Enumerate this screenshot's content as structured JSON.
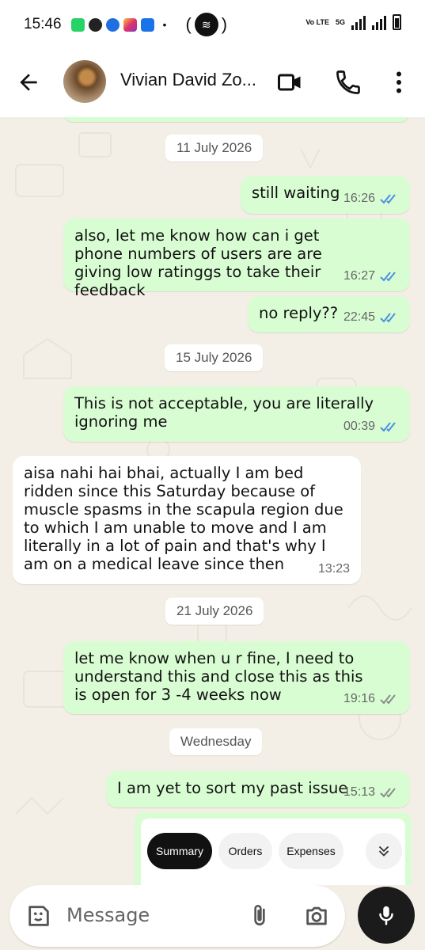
{
  "status_bar": {
    "time": "15:46",
    "network_top": "Vo LTE",
    "network_label": "5G"
  },
  "header": {
    "contact_name": "Vivian David Zo..."
  },
  "messages": [
    {
      "type": "date",
      "text": "11 July 2026"
    },
    {
      "type": "out",
      "text": "still waiting",
      "time": "16:26",
      "status": "read"
    },
    {
      "type": "out",
      "text": "also, let me know how can i get phone numbers of users are are giving low ratinggs to take their feedback",
      "time": "16:27",
      "status": "read"
    },
    {
      "type": "out",
      "text": "no reply??",
      "time": "22:45",
      "status": "read"
    },
    {
      "type": "date",
      "text": "15 July 2026"
    },
    {
      "type": "out",
      "text": "This is not acceptable, you are literally ignoring me",
      "time": "00:39",
      "status": "read"
    },
    {
      "type": "in",
      "text": "aisa nahi hai bhai, actually I am bed ridden since this Saturday because of muscle spasms in the scapula region due to which I am unable to move and I am literally in a lot of pain and that's why I am on a medical leave since then",
      "time": "13:23"
    },
    {
      "type": "date",
      "text": "21 July 2026"
    },
    {
      "type": "out",
      "text": "let me know when u r fine, I need to understand this and close this as this is open for 3 -4 weeks now",
      "time": "19:16",
      "status": "delivered"
    },
    {
      "type": "date",
      "text": "Wednesday"
    },
    {
      "type": "out",
      "text": "I am yet to sort my past issue",
      "time": "15:13",
      "status": "delivered"
    }
  ],
  "card": {
    "tabs": [
      "Summary",
      "Orders",
      "Expenses"
    ],
    "active_tab": "Summary"
  },
  "composer": {
    "placeholder": "Message"
  },
  "colors": {
    "outgoing_bubble": "#d9fdd3",
    "incoming_bubble": "#ffffff",
    "read_tick": "#4a90e2",
    "delivered_tick": "#8a8a8a",
    "chat_background": "#f3efe7"
  }
}
